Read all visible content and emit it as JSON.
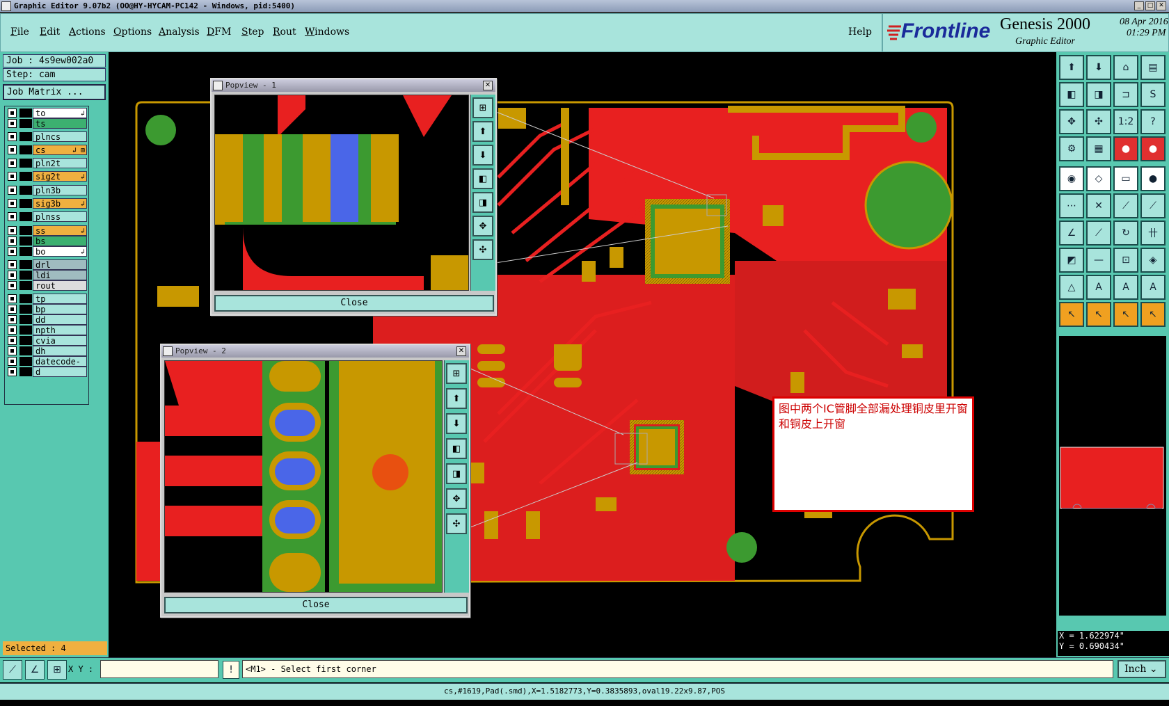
{
  "window": {
    "title": "Graphic Editor 9.07b2 (OO@HY-HYCAM-PC142 - Windows, pid:5400)"
  },
  "menu": {
    "items": [
      {
        "first": "F",
        "rest": "ile"
      },
      {
        "first": "E",
        "rest": "dit"
      },
      {
        "first": "A",
        "rest": "ctions"
      },
      {
        "first": "O",
        "rest": "ptions"
      },
      {
        "first": "A",
        "rest": "nalysis"
      },
      {
        "first": "D",
        "rest": "FM"
      },
      {
        "first": "S",
        "rest": "tep"
      },
      {
        "first": "R",
        "rest": "out"
      },
      {
        "first": "W",
        "rest": "indows"
      }
    ],
    "help": "Help"
  },
  "brand": {
    "logo": "Frontline",
    "product": "Genesis 2000",
    "subtitle": "Graphic Editor",
    "date": "08 Apr 2016",
    "time": "01:29 PM"
  },
  "job": {
    "job_label": "Job : 4s9ew002a0",
    "step_label": "Step: cam",
    "matrix_button": "Job Matrix ..."
  },
  "layers": [
    {
      "name": "to",
      "color": "#ffffff",
      "mark": "↲"
    },
    {
      "name": "ts",
      "color": "#3cb070",
      "mark": ""
    },
    {
      "name": "plncs",
      "color": "#a8e4dc",
      "mark": ""
    },
    {
      "name": "cs",
      "color": "#f0b040",
      "mark": "↲ ⊞"
    },
    {
      "name": "pln2t",
      "color": "#a8e4dc",
      "mark": ""
    },
    {
      "name": "sig2t",
      "color": "#f0b040",
      "mark": "↲"
    },
    {
      "name": "pln3b",
      "color": "#a8e4dc",
      "mark": ""
    },
    {
      "name": "sig3b",
      "color": "#f0b040",
      "mark": "↲"
    },
    {
      "name": "plnss",
      "color": "#a8e4dc",
      "mark": ""
    },
    {
      "name": "ss",
      "color": "#f0b040",
      "mark": "↲"
    },
    {
      "name": "bs",
      "color": "#3cb070",
      "mark": ""
    },
    {
      "name": "bo",
      "color": "#ffffff",
      "mark": "↲"
    },
    {
      "name": "drl",
      "color": "#a0bcc0",
      "mark": ""
    },
    {
      "name": "ldi",
      "color": "#a0bcc0",
      "mark": ""
    },
    {
      "name": "rout",
      "color": "#dddddd",
      "mark": ""
    },
    {
      "name": "tp",
      "color": "#a8e4dc",
      "mark": ""
    },
    {
      "name": "bp",
      "color": "#a8e4dc",
      "mark": ""
    },
    {
      "name": "dd",
      "color": "#a8e4dc",
      "mark": ""
    },
    {
      "name": "npth",
      "color": "#a8e4dc",
      "mark": ""
    },
    {
      "name": "cvia",
      "color": "#a8e4dc",
      "mark": ""
    },
    {
      "name": "dh",
      "color": "#a8e4dc",
      "mark": ""
    },
    {
      "name": "datecode-to",
      "color": "#a8e4dc",
      "mark": ""
    },
    {
      "name": "d",
      "color": "#a8e4dc",
      "mark": ""
    }
  ],
  "popviews": [
    {
      "title": "Popview - 1",
      "close": "Close"
    },
    {
      "title": "Popview - 2",
      "close": "Close"
    }
  ],
  "note": {
    "text": "图中两个IC管脚全部漏处理铜皮里开窗和铜皮上开窗"
  },
  "status": {
    "selected": "Selected : 4",
    "xy_label": "X Y :",
    "xy_value": "",
    "warn": "!",
    "prompt": "<M1> - Select first corner",
    "unit": "Inch",
    "info": "cs,#1619,Pad(.smd),X=1.5182773,Y=0.3835893,oval19.22x9.87,POS"
  },
  "coords": {
    "x": "X = 1.622974\"",
    "y": "Y = 0.690434\""
  },
  "toolbar": {
    "rows": [
      [
        "⬆",
        "⬇",
        "⌂",
        "▤"
      ],
      [
        "◧",
        "◨",
        "⊐",
        "S"
      ],
      [
        "✥",
        "✣",
        "1:2",
        "?"
      ],
      [
        "⚙",
        "▦",
        "●",
        "●"
      ],
      [
        "◉",
        "◇",
        "▭",
        "●"
      ],
      [
        "⋯",
        "✕",
        "⟋",
        "⟋"
      ],
      [
        "∠",
        "⟋",
        "↻",
        "卄"
      ],
      [
        "◩",
        "—",
        "⊡",
        "◈"
      ],
      [
        "△",
        "A",
        "A",
        "A"
      ],
      [
        "↖",
        "↖",
        "↖",
        "↖"
      ]
    ],
    "colors": {
      "normal": "#a8e4dc",
      "red_row_index": 3,
      "orange_row_index": 9
    }
  },
  "colors": {
    "copper": "#e82020",
    "pad": "#c89800",
    "mask": "#3c9a30",
    "highlight": "#4a66e8",
    "panel": "#58c8b0",
    "panel_light": "#a8e4dc"
  }
}
